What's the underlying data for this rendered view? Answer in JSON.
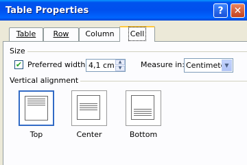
{
  "window": {
    "title": "Table Properties",
    "help_glyph": "?",
    "close_glyph": "✕"
  },
  "tabs": [
    {
      "label": "Table",
      "mnemonic": "T",
      "active": false
    },
    {
      "label": "Row",
      "mnemonic": "R",
      "active": false
    },
    {
      "label": "Column",
      "mnemonic": "U",
      "active": false
    },
    {
      "label": "Cell",
      "mnemonic": "E",
      "active": true
    }
  ],
  "size_group": {
    "label": "Size",
    "preferred_width_checked": true,
    "preferred_width_label": "Preferred width:",
    "preferred_width_value": "4,1 cm",
    "measure_in_label": "Measure in:",
    "measure_in_value": "Centimeter"
  },
  "valign_group": {
    "label": "Vertical alignment",
    "options": [
      {
        "label": "Top",
        "selected": true
      },
      {
        "label": "Center",
        "selected": false
      },
      {
        "label": "Bottom",
        "selected": false
      }
    ]
  },
  "colors": {
    "titlebar": "#0050ee",
    "face": "#ece9d8",
    "tab_highlight": "#ffc83c",
    "selection": "#316ac5"
  }
}
